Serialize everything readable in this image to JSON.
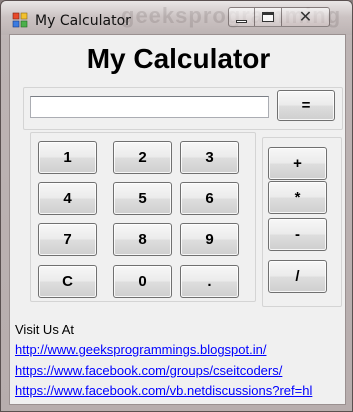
{
  "window": {
    "title": "My Calculator"
  },
  "heading": "My Calculator",
  "display": {
    "value": ""
  },
  "buttons": {
    "equals": "=",
    "digits": {
      "one": "1",
      "two": "2",
      "three": "3",
      "four": "4",
      "five": "5",
      "six": "6",
      "seven": "7",
      "eight": "8",
      "nine": "9",
      "zero": "0"
    },
    "clear": "C",
    "decimal": ".",
    "plus": "+",
    "multiply": "*",
    "minus": "-",
    "divide": "/"
  },
  "footer": {
    "visit_label": "Visit Us At",
    "links": [
      "http://www.geeksprogrammings.blogspot.in/",
      "https://www.facebook.com/groups/cseitcoders/",
      "https://www.facebook.com/vb.netdiscussions?ref=hl"
    ]
  },
  "colors": {
    "link": "#0000ff",
    "window_frame": "#b7adad",
    "client_bg": "#f0f0f0"
  },
  "icons": [
    "app-icon",
    "minimize-icon",
    "maximize-icon",
    "close-icon"
  ]
}
